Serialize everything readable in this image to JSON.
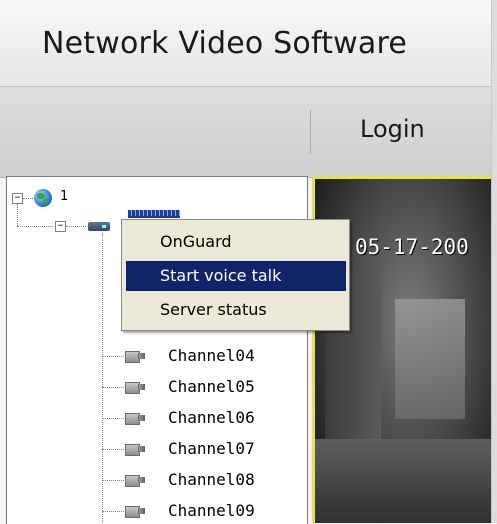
{
  "app": {
    "title": "Network Video Software"
  },
  "toolbar": {
    "login_label": "Login"
  },
  "tree": {
    "root": {
      "label": "1",
      "expander": "−"
    },
    "device": {
      "expander": "−"
    },
    "channels": [
      "Channel04",
      "Channel05",
      "Channel06",
      "Channel07",
      "Channel08",
      "Channel09"
    ]
  },
  "video": {
    "osd_timestamp": "05-17-200"
  },
  "context_menu": {
    "items": [
      "OnGuard",
      "Start voice talk",
      "Server status"
    ],
    "selected": "Start voice talk"
  },
  "colors": {
    "selection": "#10246a",
    "video_border": "#e4e44a",
    "menu_bg": "#ece9d8"
  }
}
